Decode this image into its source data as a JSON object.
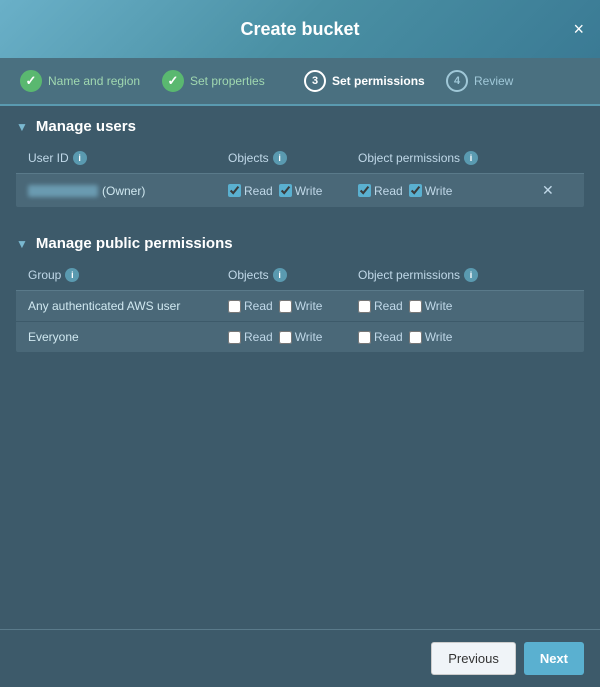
{
  "modal": {
    "title": "Create bucket",
    "close_label": "×"
  },
  "steps": [
    {
      "id": 1,
      "label": "Name and region",
      "state": "completed"
    },
    {
      "id": 2,
      "label": "Set properties",
      "state": "completed"
    },
    {
      "id": 3,
      "label": "Set permissions",
      "state": "active"
    },
    {
      "id": 4,
      "label": "Review",
      "state": "inactive"
    }
  ],
  "sections": {
    "manage_users": {
      "title": "Manage users",
      "table": {
        "headers": {
          "user_id": "User ID",
          "objects": "Objects",
          "object_permissions": "Object permissions"
        },
        "rows": [
          {
            "user_id_blurred": true,
            "user_id_suffix": "(Owner)",
            "objects_read": true,
            "objects_write": true,
            "obj_perm_read": true,
            "obj_perm_write": true
          }
        ]
      }
    },
    "manage_public": {
      "title": "Manage public permissions",
      "table": {
        "headers": {
          "group": "Group",
          "objects": "Objects",
          "object_permissions": "Object permissions"
        },
        "rows": [
          {
            "group": "Any authenticated AWS user",
            "objects_read": false,
            "objects_write": false,
            "obj_perm_read": false,
            "obj_perm_write": false
          },
          {
            "group": "Everyone",
            "objects_read": false,
            "objects_write": false,
            "obj_perm_read": false,
            "obj_perm_write": false
          }
        ]
      }
    }
  },
  "footer": {
    "previous_label": "Previous",
    "next_label": "Next"
  },
  "labels": {
    "read": "Read",
    "write": "Write"
  }
}
